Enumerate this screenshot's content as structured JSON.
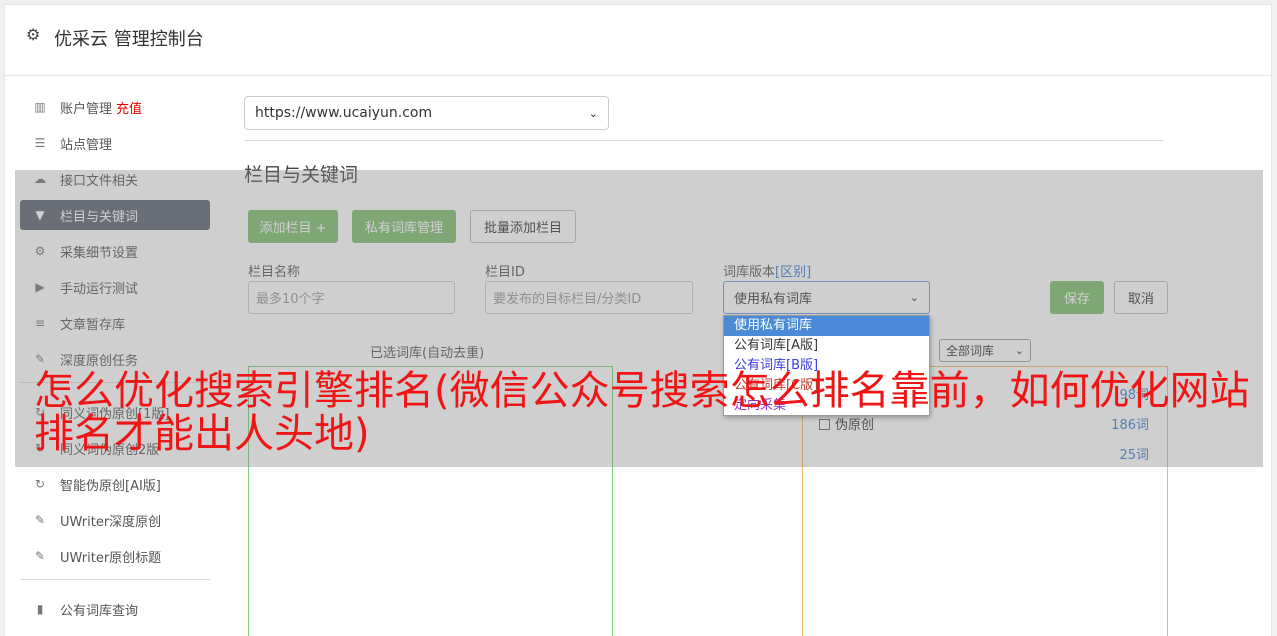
{
  "header": {
    "title": "优采云 管理控制台"
  },
  "sidebar": {
    "items": [
      {
        "label": "账户管理",
        "extra": "充值"
      },
      {
        "label": "站点管理"
      },
      {
        "label": "接口文件相关"
      },
      {
        "label": "栏目与关键词"
      },
      {
        "label": "采集细节设置"
      },
      {
        "label": "手动运行测试"
      },
      {
        "label": "文章暂存库"
      },
      {
        "label": "深度原创任务"
      }
    ],
    "items2": [
      {
        "label": "同义词伪原创[1版]"
      },
      {
        "label": "同义词伪原创2版"
      },
      {
        "label": "智能伪原创[AI版]"
      },
      {
        "label": "UWriter深度原创"
      },
      {
        "label": "UWriter原创标题"
      }
    ],
    "items3": [
      {
        "label": "公有词库查询"
      }
    ]
  },
  "main": {
    "site_select": "https://www.ucaiyun.com",
    "section_title": "栏目与关键词",
    "buttons": {
      "add_column": "添加栏目 +",
      "private_lib": "私有词库管理",
      "batch_add": "批量添加栏目",
      "save": "保存",
      "cancel": "取消"
    },
    "form": {
      "column_name_label": "栏目名称",
      "column_name_placeholder": "最多10个字",
      "column_id_label": "栏目ID",
      "column_id_placeholder": "要发布的目标栏目/分类ID",
      "lib_version_label": "词库版本",
      "lib_version_link": "[区别]",
      "lib_version_value": "使用私有词库"
    },
    "selected_lib_label": "已选词库(自动去重)",
    "all_lib_select": "全部词库",
    "lib_rows": [
      {
        "label": "",
        "count": "98词"
      },
      {
        "label": "伪原创",
        "count": "186词"
      },
      {
        "label": "",
        "count": "25词"
      }
    ],
    "dropdown_options": [
      {
        "label": "使用私有词库",
        "color": "#ffffff",
        "bg": "#4a8ad6"
      },
      {
        "label": "公有词库[A版]",
        "color": "#333333",
        "bg": "#ffffff"
      },
      {
        "label": "公有词库[B版]",
        "color": "#3a3ae0",
        "bg": "#ffffff"
      },
      {
        "label": "公有词库[C版]",
        "color": "#c0392b",
        "bg": "#ffffff"
      },
      {
        "label": "定向采集",
        "color": "#8e3ac9",
        "bg": "#ffffff"
      }
    ]
  },
  "overlay_text": "怎么优化搜索引擎排名(微信公众号搜索怎么排名靠前，如何优化网站排名才能出人头地)"
}
